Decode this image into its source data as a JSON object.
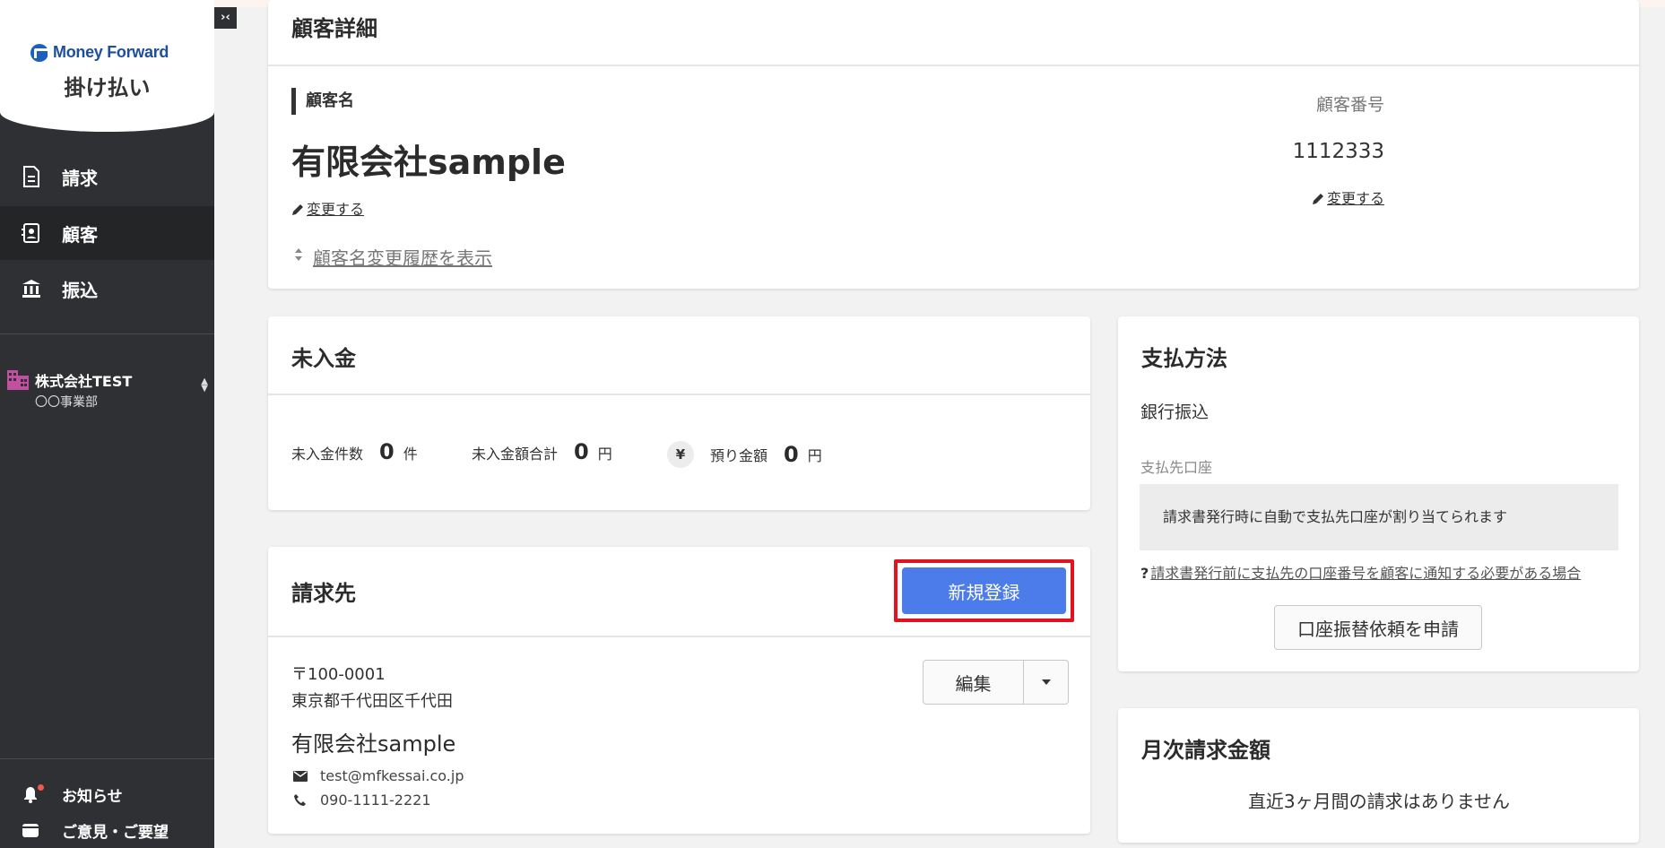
{
  "app": {
    "brand_name": "Money Forward",
    "brand_sub": "掛け払い",
    "brand_color": "#1d5fbf",
    "collapse_label": "›‹"
  },
  "sidebar": {
    "items": [
      {
        "label": "請求",
        "icon": "document-icon",
        "active": false
      },
      {
        "label": "顧客",
        "icon": "customer-icon",
        "active": true
      },
      {
        "label": "振込",
        "icon": "bank-icon",
        "active": false
      }
    ],
    "company": {
      "name": "株式会社TEST",
      "department": "〇〇事業部",
      "icon": "building-icon"
    },
    "bottom": [
      {
        "label": "お知らせ",
        "icon": "bell-icon"
      },
      {
        "label": "ご意見・ご要望",
        "icon": "feedback-icon"
      }
    ]
  },
  "customer_detail": {
    "title": "顧客詳細",
    "name_label": "顧客名",
    "name": "有限会社sample",
    "change_label": "変更する",
    "number_label": "顧客番号",
    "number": "1112333",
    "history_link": "顧客名変更履歴を表示"
  },
  "unpaid": {
    "title": "未入金",
    "count_label": "未入金件数",
    "count_value": "0",
    "count_unit": "件",
    "total_label": "未入金額合計",
    "total_value": "0",
    "total_unit": "円",
    "deposit_icon": "¥",
    "deposit_label": "預り金額",
    "deposit_value": "0",
    "deposit_unit": "円"
  },
  "billing": {
    "title": "請求先",
    "new_button": "新規登録",
    "edit_button": "編集",
    "postal": "〒100-0001",
    "address": "東京都千代田区千代田",
    "name": "有限会社sample",
    "email": "test@mfkessai.co.jp",
    "phone": "090-1111-2221",
    "highlight_color": "#e0131f",
    "primary_color": "#4c7bea"
  },
  "payment": {
    "title": "支払方法",
    "method": "銀行振込",
    "account_label": "支払先口座",
    "account_note": "請求書発行時に自動で支払先口座が割り当てられます",
    "help_link": "請求書発行前に支払先の口座番号を顧客に通知する必要がある場合",
    "transfer_button": "口座振替依頼を申請"
  },
  "monthly": {
    "title": "月次請求金額",
    "empty": "直近3ヶ月間の請求はありません"
  }
}
